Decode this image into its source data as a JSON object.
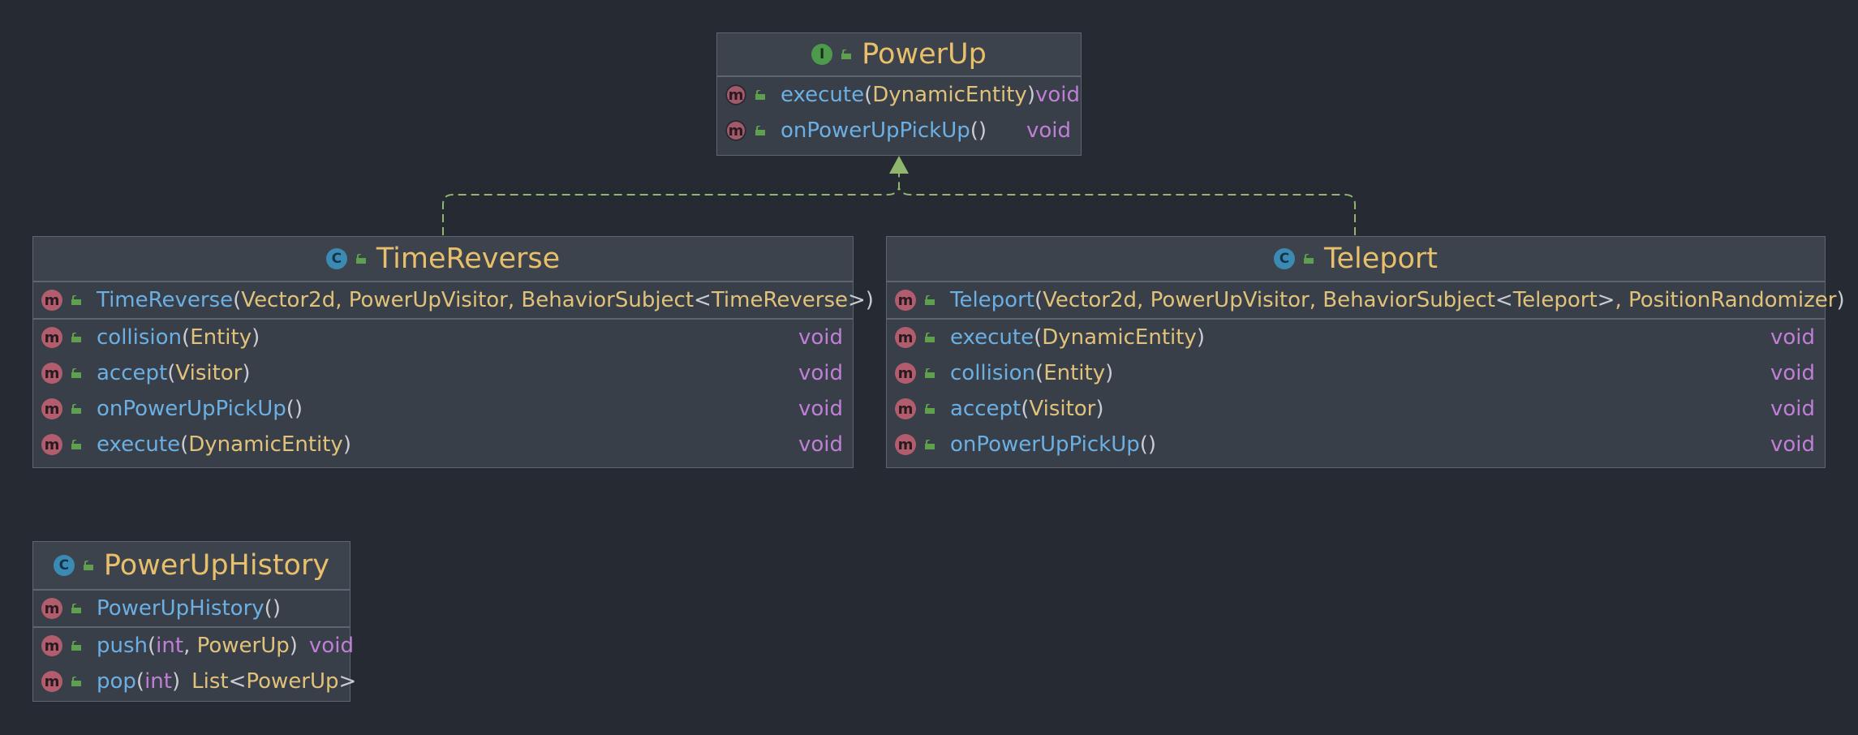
{
  "colors": {
    "background": "#262b33",
    "class_name": "#e8bf6a",
    "method_name": "#6bafe3",
    "param_type": "#e0c27b",
    "keyword": "#c07fd6",
    "connector": "#8fb56e"
  },
  "powerup": {
    "kind_icon": "I",
    "name": "PowerUp",
    "methods": [
      {
        "icon": "m",
        "name": "execute",
        "params": "DynamicEntity",
        "ret": "void"
      },
      {
        "icon": "m",
        "name": "onPowerUpPickUp",
        "params": "",
        "ret": "void"
      }
    ]
  },
  "timereverse": {
    "kind_icon": "C",
    "name": "TimeReverse",
    "ctor": {
      "icon": "m",
      "name": "TimeReverse ",
      "params_a": "Vector2d, PowerUpVisitor, BehaviorSubject",
      "lt": "<",
      "params_b": "TimeReverse ",
      "gt": ">"
    },
    "methods": [
      {
        "icon": "m",
        "name": "collision",
        "params": "Entity",
        "ret": "void"
      },
      {
        "icon": "m",
        "name": "accept",
        "params": "Visitor",
        "ret": "void"
      },
      {
        "icon": "m",
        "name": "onPowerUpPickUp",
        "params": "",
        "ret": "void"
      },
      {
        "icon": "m",
        "name": "execute",
        "params": "DynamicEntity",
        "ret": "void"
      }
    ]
  },
  "teleport": {
    "kind_icon": "C",
    "name": "Teleport",
    "ctor": {
      "icon": "m",
      "name": "Teleport ",
      "params_a": "Vector2d, PowerUpVisitor, BehaviorSubject",
      "lt": "<",
      "params_b": "Teleport ",
      "gt": ">",
      "params_c": ", PositionRandomizer"
    },
    "methods": [
      {
        "icon": "m",
        "name": "execute",
        "params": "DynamicEntity",
        "ret": "void"
      },
      {
        "icon": "m",
        "name": "collision",
        "params": "Entity",
        "ret": "void"
      },
      {
        "icon": "m",
        "name": "accept",
        "params": "Visitor",
        "ret": "void"
      },
      {
        "icon": "m",
        "name": "onPowerUpPickUp",
        "params": "",
        "ret": "void"
      }
    ]
  },
  "history": {
    "kind_icon": "C",
    "name": "PowerUpHistory",
    "ctor": {
      "icon": "m",
      "name": "PowerUpHistory"
    },
    "push": {
      "icon": "m",
      "name": "push",
      "p1": "int",
      "sep": ", ",
      "p2": "PowerUp",
      "ret": "void"
    },
    "pop": {
      "icon": "m",
      "name": "pop",
      "p1": "int",
      "ret_a": "List",
      "ret_lt": "<",
      "ret_b": "PowerUp",
      "ret_gt": ">"
    }
  },
  "punct": {
    "open": "(",
    "close": ")"
  }
}
